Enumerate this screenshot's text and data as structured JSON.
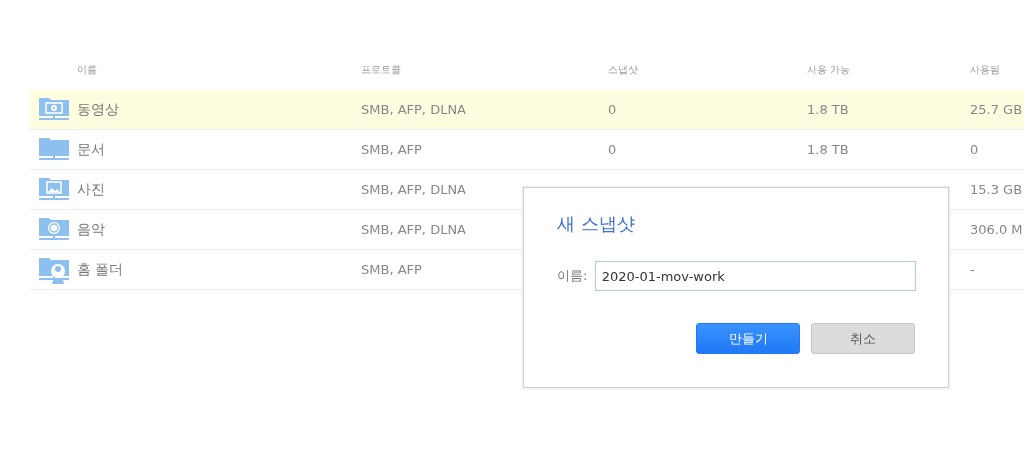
{
  "table": {
    "columns": [
      "이름",
      "프로토콜",
      "스냅샷",
      "사용 가능",
      "사용됨"
    ],
    "rows": [
      {
        "kind": "video",
        "name": "동영상",
        "protocol": "SMB, AFP, DLNA",
        "snapshots": "0",
        "available": "1.8 TB",
        "used": "25.7 GB",
        "selected": true
      },
      {
        "kind": "plain",
        "name": "문서",
        "protocol": "SMB, AFP",
        "snapshots": "0",
        "available": "1.8 TB",
        "used": "0",
        "selected": false
      },
      {
        "kind": "photo",
        "name": "사진",
        "protocol": "SMB, AFP, DLNA",
        "used": "15.3 GB",
        "selected": false
      },
      {
        "kind": "music",
        "name": "음악",
        "protocol": "SMB, AFP, DLNA",
        "used": "306.0 M",
        "selected": false
      },
      {
        "kind": "home",
        "name": "홈 폴더",
        "protocol": "SMB, AFP",
        "used": "-",
        "selected": false
      }
    ]
  },
  "dialog": {
    "title": "새 스냅샷",
    "field_label": "이름:",
    "value": "2020-01-mov-work",
    "buttons": [
      {
        "label": "만들기",
        "kind": "primary"
      },
      {
        "label": "취소",
        "kind": "secondary"
      }
    ]
  }
}
